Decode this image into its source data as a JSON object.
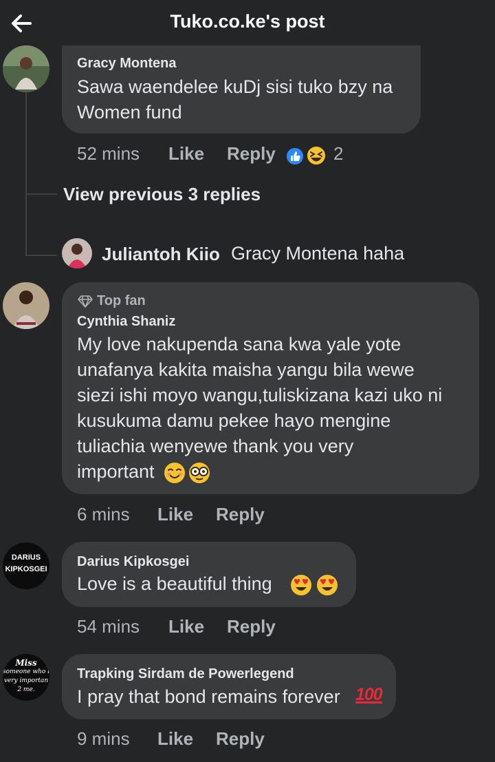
{
  "header": {
    "title": "Tuko.co.ke's post"
  },
  "comments": [
    {
      "author": "Gracy Montena",
      "lines": [
        "Sawa waendelee kuDj sisi tuko bzy na",
        "Women fund"
      ],
      "time": "52 mins",
      "like": "Like",
      "reply": "Reply",
      "reaction_count": "2"
    },
    {
      "badge": "Top fan",
      "author": "Cynthia Shaniz",
      "lines": [
        "My love nakupenda sana kwa yale yote",
        "unafanya kakita maisha yangu bila wewe",
        "siezi ishi moyo wangu,tuliskizana kazi uko ni",
        "kusukuma damu pekee hayo mengine",
        "tuliachia wenyewe thank you very",
        "important"
      ],
      "time": "6 mins",
      "like": "Like",
      "reply": "Reply"
    },
    {
      "author": "Darius Kipkosgei",
      "avatar_lines": [
        "DARIUS",
        "KIPKOSGEI"
      ],
      "lines": [
        "Love is a beautiful thing"
      ],
      "time": "54 mins",
      "like": "Like",
      "reply": "Reply"
    },
    {
      "author": "Trapking Sirdam de Powerlegend",
      "avatar_lines": [
        "Miss",
        "someone who i",
        "very importan",
        "2 me."
      ],
      "lines": [
        "I pray that bond remains forever"
      ],
      "hundred": "100",
      "time": "9 mins",
      "like": "Like",
      "reply": "Reply"
    }
  ],
  "thread": {
    "view_previous": "View previous 3 replies",
    "reply_author": "Juliantoh Kiio",
    "reply_text": "Gracy Montena haha"
  },
  "colors": {
    "background": "#242526",
    "bubble": "#3a3b3c",
    "text": "#e4e6eb",
    "muted": "#b0b3b8",
    "like_blue": "#2e89ff",
    "emoji_yellow": "#f7c22f",
    "hundred_red": "#e8293a"
  },
  "icons": {
    "back": "arrow-left-icon",
    "top_fan": "diamond-icon",
    "like_reaction": "thumbs-up-icon",
    "haha_reaction": "laughing-face-icon"
  }
}
